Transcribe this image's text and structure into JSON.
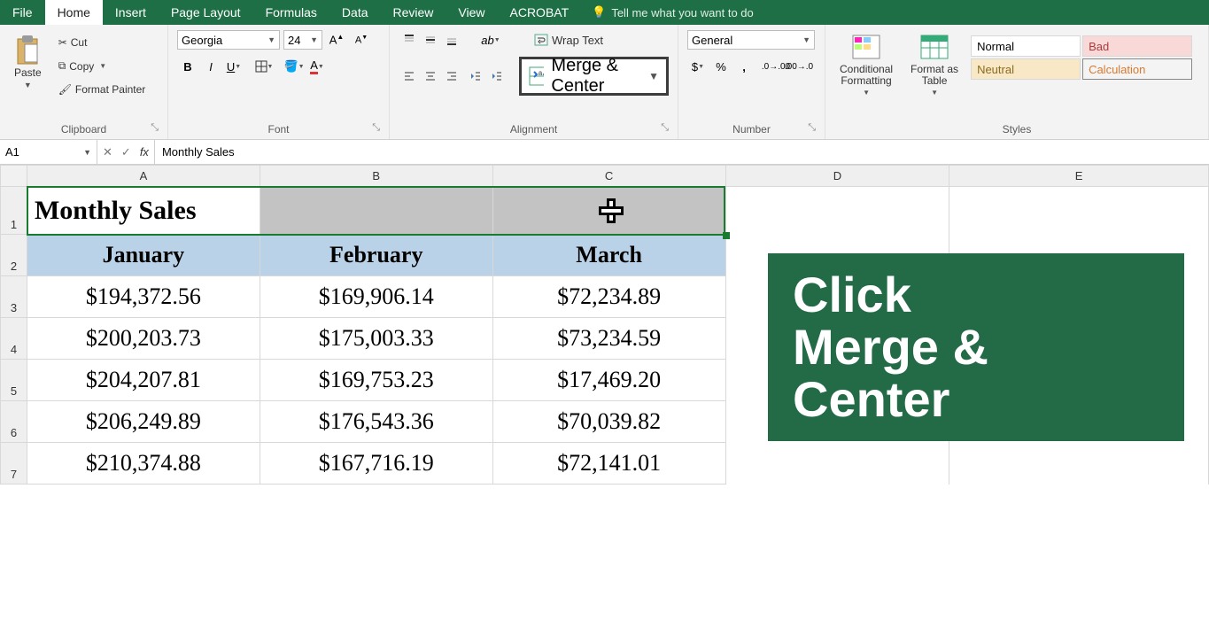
{
  "tabs": {
    "file": "File",
    "home": "Home",
    "insert": "Insert",
    "page_layout": "Page Layout",
    "formulas": "Formulas",
    "data": "Data",
    "review": "Review",
    "view": "View",
    "acrobat": "ACROBAT",
    "tell_me": "Tell me what you want to do"
  },
  "ribbon": {
    "clipboard": {
      "label": "Clipboard",
      "paste": "Paste",
      "cut": "Cut",
      "copy": "Copy",
      "format_painter": "Format Painter"
    },
    "font": {
      "label": "Font",
      "name": "Georgia",
      "size": "24"
    },
    "alignment": {
      "label": "Alignment",
      "wrap_text": "Wrap Text",
      "merge_center": "Merge & Center"
    },
    "number": {
      "label": "Number",
      "format": "General"
    },
    "styles": {
      "label": "Styles",
      "conditional": "Conditional\nFormatting",
      "format_table": "Format as\nTable",
      "normal": "Normal",
      "bad": "Bad",
      "neutral": "Neutral",
      "calculation": "Calculation"
    }
  },
  "formula_bar": {
    "cell_ref": "A1",
    "content": "Monthly Sales"
  },
  "grid": {
    "cols": [
      "A",
      "B",
      "C",
      "D",
      "E"
    ],
    "title": "Monthly Sales",
    "headers": [
      "January",
      "February",
      "March"
    ],
    "rows": [
      [
        "$194,372.56",
        "$169,906.14",
        "$72,234.89"
      ],
      [
        "$200,203.73",
        "$175,003.33",
        "$73,234.59"
      ],
      [
        "$204,207.81",
        "$169,753.23",
        "$17,469.20"
      ],
      [
        "$206,249.89",
        "$176,543.36",
        "$70,039.82"
      ],
      [
        "$210,374.88",
        "$167,716.19",
        "$72,141.01"
      ]
    ]
  },
  "callout": {
    "line1": "Click",
    "line2": "Merge &",
    "line3": "Center"
  }
}
